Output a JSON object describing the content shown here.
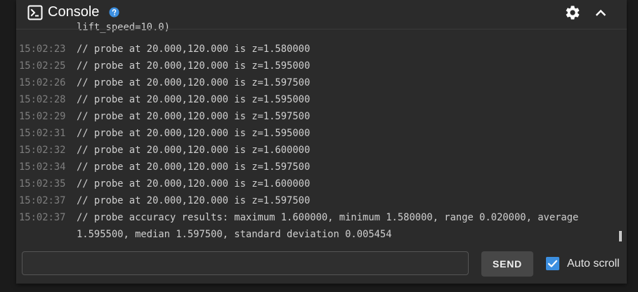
{
  "header": {
    "title": "Console",
    "title_icon": "terminal-icon",
    "help_icon": "help-circle-icon",
    "settings_icon": "gear-icon",
    "collapse_icon": "chevron-up-icon"
  },
  "log": {
    "partial_line": "lift_speed=10.0)",
    "lines": [
      {
        "time": "15:02:23",
        "text": "// probe at 20.000,120.000 is z=1.580000"
      },
      {
        "time": "15:02:25",
        "text": "// probe at 20.000,120.000 is z=1.595000"
      },
      {
        "time": "15:02:26",
        "text": "// probe at 20.000,120.000 is z=1.597500"
      },
      {
        "time": "15:02:28",
        "text": "// probe at 20.000,120.000 is z=1.595000"
      },
      {
        "time": "15:02:29",
        "text": "// probe at 20.000,120.000 is z=1.597500"
      },
      {
        "time": "15:02:31",
        "text": "// probe at 20.000,120.000 is z=1.595000"
      },
      {
        "time": "15:02:32",
        "text": "// probe at 20.000,120.000 is z=1.600000"
      },
      {
        "time": "15:02:34",
        "text": "// probe at 20.000,120.000 is z=1.597500"
      },
      {
        "time": "15:02:35",
        "text": "// probe at 20.000,120.000 is z=1.600000"
      },
      {
        "time": "15:02:37",
        "text": "// probe at 20.000,120.000 is z=1.597500"
      },
      {
        "time": "15:02:37",
        "text": "// probe accuracy results: maximum 1.600000, minimum 1.580000, range 0.020000, average"
      },
      {
        "time": "",
        "text": "1.595500, median 1.597500, standard deviation 0.005454"
      }
    ]
  },
  "input": {
    "value": "",
    "placeholder": ""
  },
  "send_button": {
    "label": "SEND"
  },
  "autoscroll": {
    "label": "Auto scroll",
    "checked": true
  },
  "colors": {
    "background": "#1b1b1b",
    "panel": "#2b2b2b",
    "accent": "#3c8fe0",
    "timestamp": "#7e7e7e",
    "message": "#cfcfcf",
    "button": "#474747"
  }
}
